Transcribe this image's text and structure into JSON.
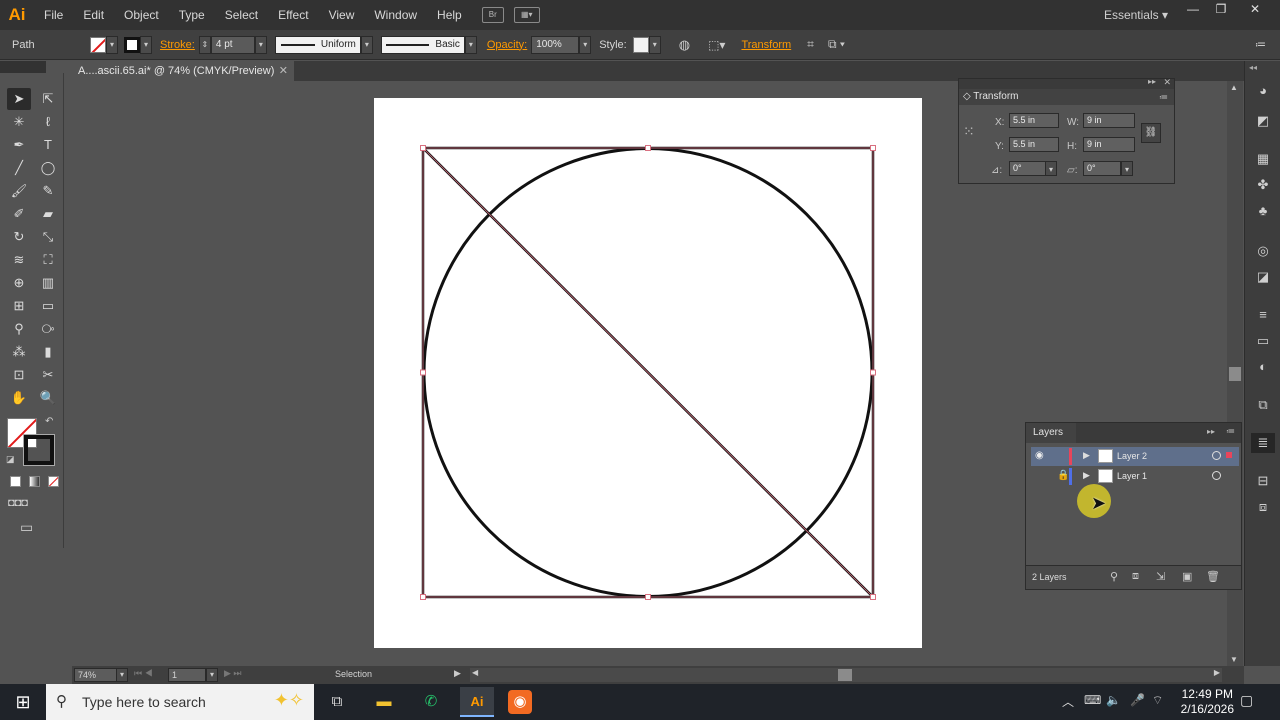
{
  "app": {
    "logo": "Ai"
  },
  "menubar": {
    "items": [
      "File",
      "Edit",
      "Object",
      "Type",
      "Select",
      "Effect",
      "View",
      "Window",
      "Help"
    ],
    "bridge_label": "Br",
    "workspace": "Essentials"
  },
  "controlbar": {
    "selection_type": "Path",
    "stroke_label": "Stroke:",
    "stroke_weight": "4 pt",
    "profile": "Uniform",
    "brush": "Basic",
    "opacity_label": "Opacity:",
    "opacity": "100%",
    "style_label": "Style:",
    "transform_link": "Transform"
  },
  "document": {
    "tab_title": "A....ascii.65.ai* @ 74% (CMYK/Preview)",
    "fill_color": "none",
    "stroke_color": "#000000"
  },
  "transform_panel": {
    "title": "Transform",
    "x_label": "X:",
    "x": "5.5 in",
    "y_label": "Y:",
    "y": "5.5 in",
    "w_label": "W:",
    "w": "9 in",
    "h_label": "H:",
    "h": "9 in",
    "rotate": "0°",
    "shear": "0°"
  },
  "layers_panel": {
    "title": "Layers",
    "layers": [
      {
        "name": "Layer 2",
        "color": "#e8455b",
        "selected": true
      },
      {
        "name": "Layer 1",
        "color": "#4f6fe8",
        "selected": false
      }
    ],
    "count": "2 Layers"
  },
  "statusbar": {
    "zoom": "74%",
    "artboard": "1",
    "tool": "Selection"
  },
  "taskbar": {
    "search_placeholder": "Type here to search",
    "time": "12:49 PM",
    "date": "2/16/2026"
  }
}
